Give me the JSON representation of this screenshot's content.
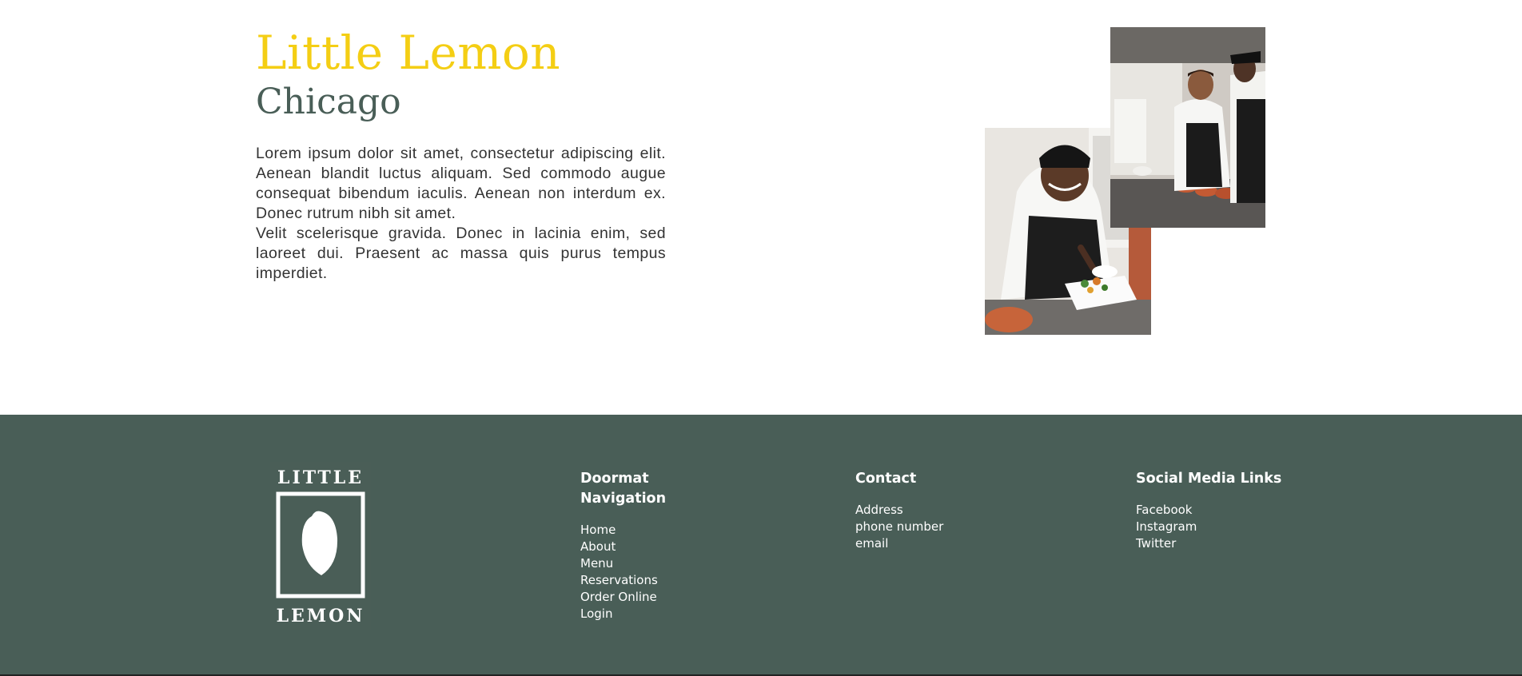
{
  "hero": {
    "title": "Little Lemon",
    "subtitle": "Chicago",
    "paragraph_1": "Lorem ipsum dolor sit amet, consectetur adipiscing elit. Aenean blandit luctus aliquam. Sed commodo augue consequat bibendum iaculis. Aenean non interdum ex. Donec rutrum nibh sit amet.",
    "paragraph_2": "Velit scelerisque gravida. Donec in lacinia enim, sed laoreet dui. Praesent ac massa quis purus tempus imperdiet."
  },
  "footer": {
    "logo": {
      "top_text": "LITTLE",
      "bottom_text": "LEMON"
    },
    "nav": {
      "heading": "Doormat Navigation",
      "items": [
        "Home",
        "About",
        "Menu",
        "Reservations",
        "Order Online",
        "Login"
      ]
    },
    "contact": {
      "heading": "Contact",
      "items": [
        "Address",
        "phone number",
        "email"
      ]
    },
    "social": {
      "heading": "Social Media Links",
      "items": [
        "Facebook",
        "Instagram",
        "Twitter"
      ]
    }
  },
  "colors": {
    "brand_yellow": "#f4ce14",
    "brand_green": "#495e57",
    "text_dark": "#333333"
  }
}
